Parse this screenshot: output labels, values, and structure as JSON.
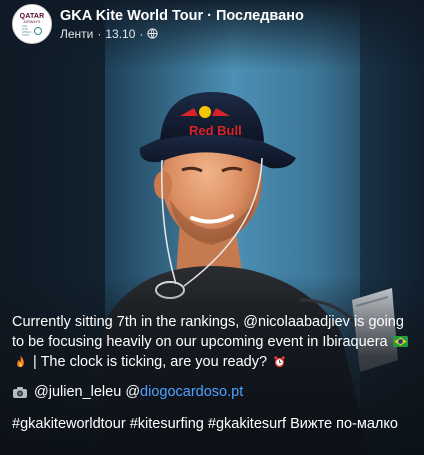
{
  "post": {
    "page_name": "GKA Kite World Tour",
    "title_separator": "·",
    "status": "Последвано",
    "feed_label": "Ленти",
    "meta_separator": "·",
    "date": "13.10",
    "privacy_icon": "globe-icon",
    "avatar": {
      "brand_line1": "QATAR",
      "brand_line2": "AIRWAYS",
      "seal_text": "GKA KITE WORLD TOUR"
    }
  },
  "photo": {
    "hat_logo_text": "Red Bull"
  },
  "caption": {
    "para1_text": "Currently sitting 7th in the rankings, @nicolaabadjiev is going to be focusing heavily on our upcoming event in Ibiraquera",
    "para1_emoji_flag": "brazil-flag-emoji",
    "para1_emoji_fire": "fire-emoji",
    "para1_tail": "| The clock is ticking, are you ready?",
    "para1_emoji_clock": "alarm-clock-emoji",
    "camera_icon": "camera-icon",
    "credit_mention1": "@julien_leleu",
    "credit_mention2": "@diogocardoso.pt",
    "hashtags": [
      "#gkakiteworldtour",
      "#kitesurfing",
      "#gkakitesurf"
    ],
    "see_more": "Вижте по-малко"
  },
  "colors": {
    "link": "#4ea0ff",
    "text": "#ffffff",
    "brand": "#5c0632"
  }
}
